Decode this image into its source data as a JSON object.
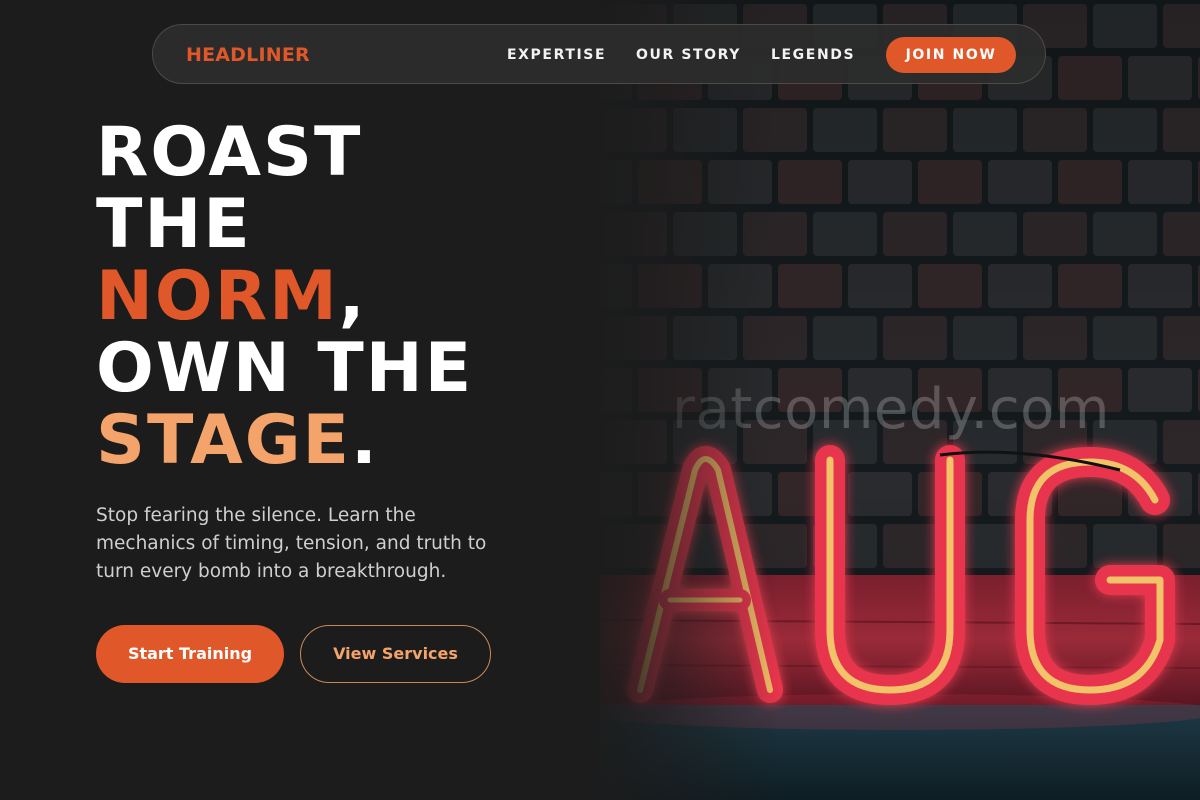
{
  "nav": {
    "brand": "HEADLINER",
    "links": [
      "EXPERTISE",
      "OUR STORY",
      "LEGENDS"
    ],
    "cta": "JOIN NOW"
  },
  "hero": {
    "line1": "ROAST",
    "line2": "THE",
    "line3_word": "NORM",
    "line3_punct": ",",
    "line4": "OWN THE",
    "line5_word": "STAGE",
    "line5_punct": ".",
    "subtitle": "Stop fearing the silence. Learn the mechanics of timing, tension, and truth to turn every bomb into a breakthrough.",
    "primary_button": "Start Training",
    "secondary_button": "View Services"
  },
  "image": {
    "neon_text": "AUG",
    "watermark": "ratcomedy.com"
  },
  "colors": {
    "background": "#1c1c1c",
    "accent_orange": "#e0582a",
    "accent_peach": "#f4a36a",
    "neon_red": "#e8354e",
    "neon_yellow": "#f3d36a"
  }
}
